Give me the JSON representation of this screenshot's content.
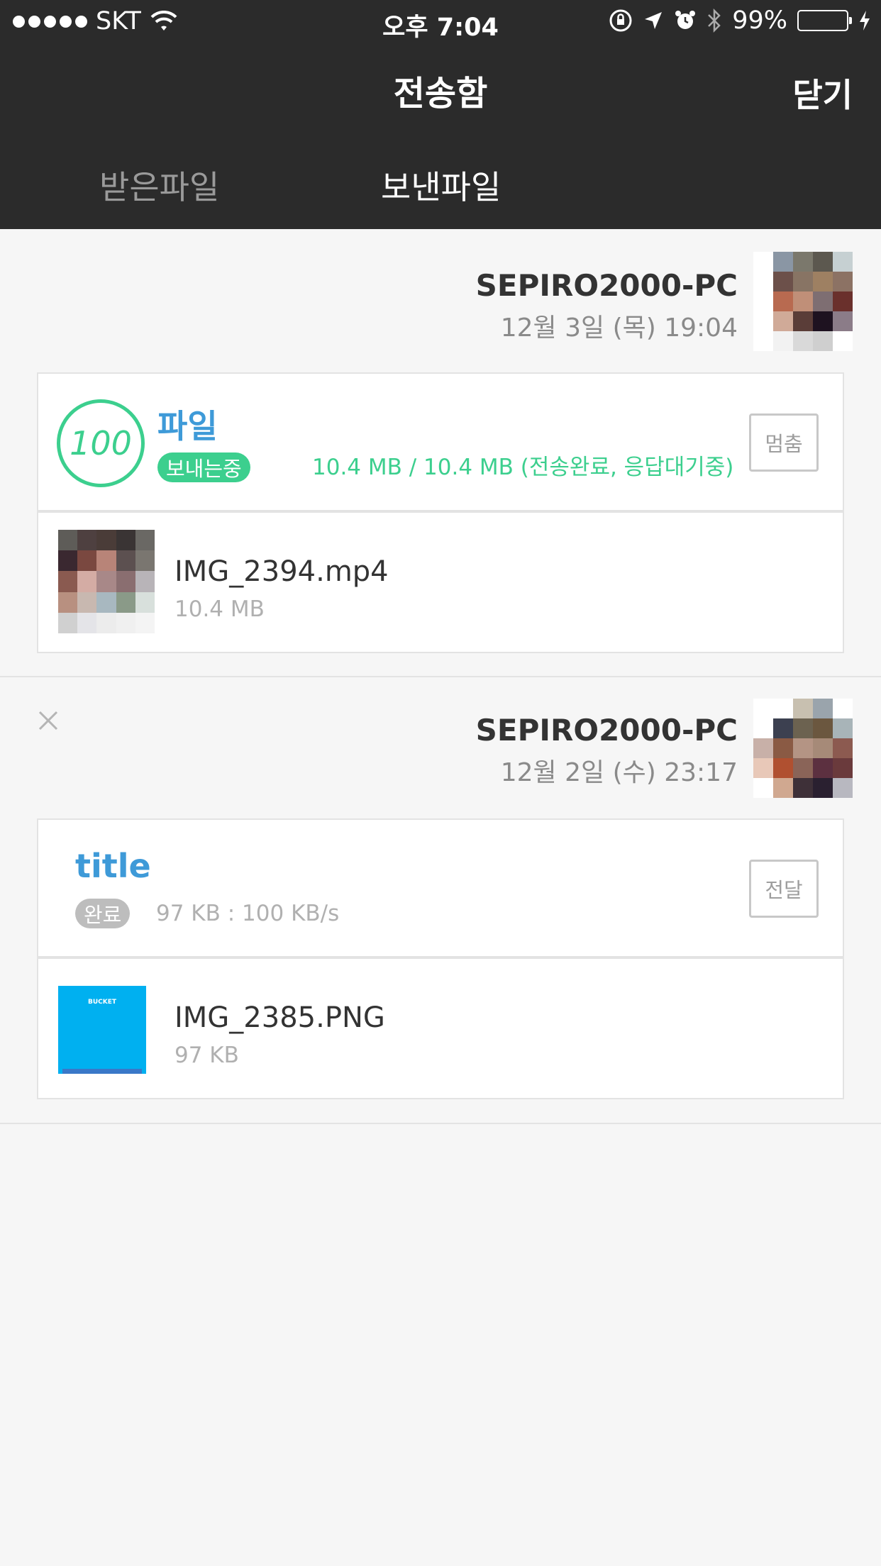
{
  "status_bar": {
    "carrier": "SKT",
    "time": "오후 7:04",
    "battery": "99%",
    "battery_level": 0.99
  },
  "header": {
    "title": "전송함",
    "close_label": "닫기",
    "tabs": [
      {
        "label": "받은파일",
        "active": false
      },
      {
        "label": "보낸파일",
        "active": true
      }
    ]
  },
  "transfers": [
    {
      "device": "SEPIRO2000-PC",
      "date": "12월 3일 (목) 19:04",
      "progress": "100",
      "title": "파일",
      "badge": "보내는중",
      "status": "10.4 MB / 10.4 MB (전송완료, 응답대기중)",
      "action": "멈춤",
      "file": {
        "name": "IMG_2394.mp4",
        "size": "10.4 MB"
      }
    },
    {
      "device": "SEPIRO2000-PC",
      "date": "12월 2일 (수) 23:17",
      "title": "title",
      "badge": "완료",
      "status": "97 KB : 100 KB/s",
      "action": "전달",
      "file": {
        "name": "IMG_2385.PNG",
        "size": "97 KB",
        "thumb_text": "BUCKET"
      }
    }
  ],
  "colors": {
    "header_bg": "#2b2b2b",
    "accent_green": "#3ccf8e",
    "accent_blue": "#3e9ad8",
    "badge_gray": "#bdbdbd",
    "thumb_blue": "#00b0f0"
  }
}
